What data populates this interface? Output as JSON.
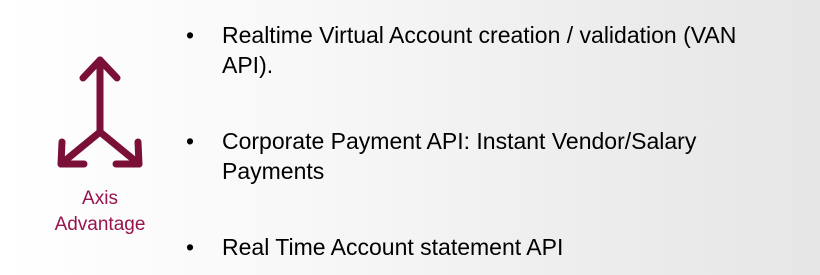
{
  "logo": {
    "icon": "three-way-arrows-icon",
    "caption_line1": "Axis",
    "caption_line2": "Advantage",
    "color": "#97144d"
  },
  "bullets": [
    {
      "marker": "•",
      "text": "Realtime Virtual Account creation / validation (VAN API)."
    },
    {
      "marker": "•",
      "text": "Corporate Payment API: Instant Vendor/Salary Payments"
    },
    {
      "marker": "•",
      "text": "Real Time Account statement API"
    }
  ]
}
